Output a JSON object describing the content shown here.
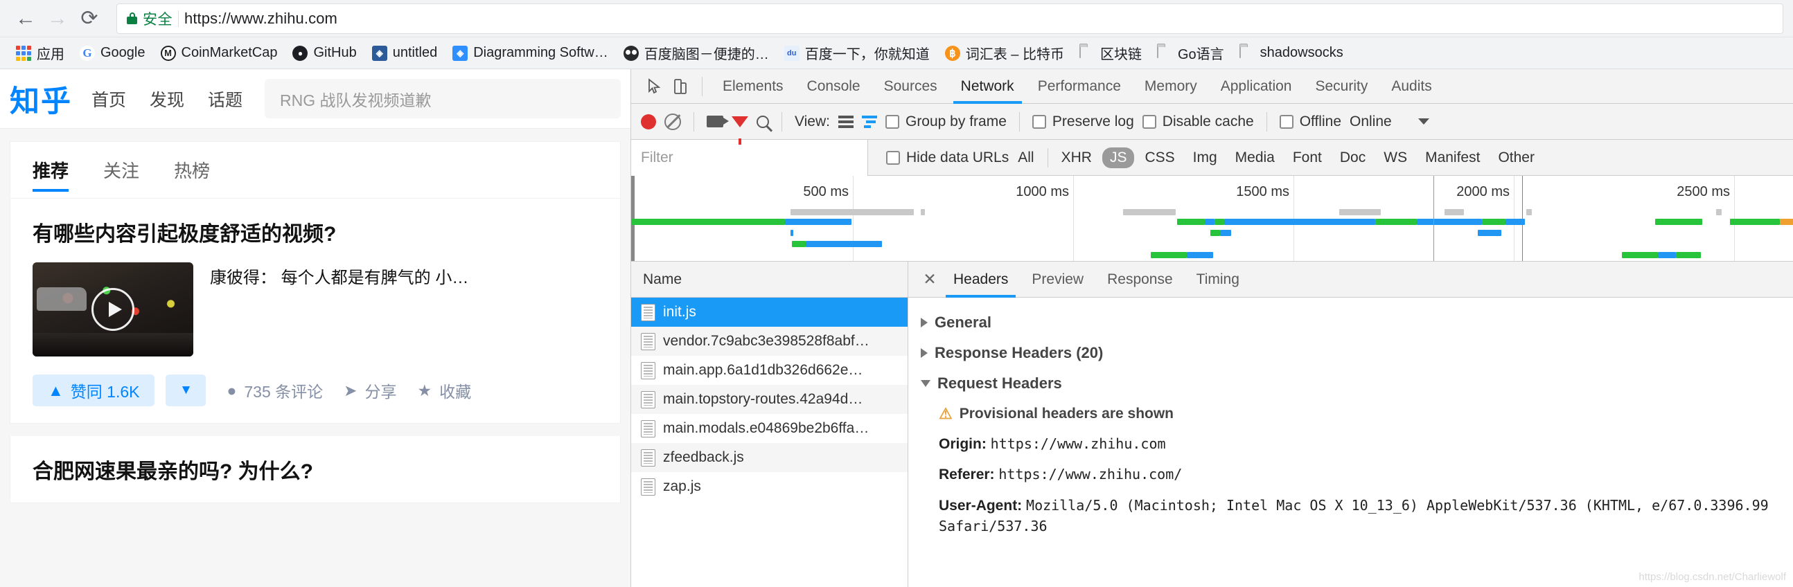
{
  "browser": {
    "back_icon": "←",
    "forward_icon": "→",
    "reload_icon": "⟳",
    "secure_label": "安全",
    "url": "https://www.zhihu.com",
    "url_scheme": "https",
    "url_sep": "://",
    "url_host": "www.zhihu.com"
  },
  "bookmarks": [
    {
      "label": "应用",
      "icon": "apps-grid-icon",
      "kind": "apps"
    },
    {
      "label": "Google",
      "icon": "google-icon",
      "kind": "google"
    },
    {
      "label": "CoinMarketCap",
      "icon": "coinmarketcap-icon",
      "kind": "cmc"
    },
    {
      "label": "GitHub",
      "icon": "github-icon",
      "kind": "github"
    },
    {
      "label": "untitled",
      "icon": "diagram-app-icon",
      "kind": "draw-dark"
    },
    {
      "label": "Diagramming Softw…",
      "icon": "diagram-app-icon",
      "kind": "draw-blue"
    },
    {
      "label": "百度脑图－便捷的…",
      "icon": "baidu-naotu-icon",
      "kind": "panda"
    },
    {
      "label": "百度一下，你就知道",
      "icon": "baidu-icon",
      "kind": "baidu"
    },
    {
      "label": "词汇表 – 比特币",
      "icon": "bitcoin-icon",
      "kind": "btc"
    },
    {
      "label": "区块链",
      "icon": "folder-icon",
      "kind": "folder"
    },
    {
      "label": "Go语言",
      "icon": "folder-icon",
      "kind": "folder"
    },
    {
      "label": "shadowsocks",
      "icon": "folder-icon",
      "kind": "folder"
    }
  ],
  "zhihu": {
    "logo": "知乎",
    "nav": [
      "首页",
      "发现",
      "话题"
    ],
    "search_placeholder": "RNG 战队发视频道歉",
    "feed_tabs": [
      {
        "label": "推荐",
        "active": true
      },
      {
        "label": "关注",
        "active": false
      },
      {
        "label": "热榜",
        "active": false
      }
    ],
    "question_title": "有哪些内容引起极度舒适的视频?",
    "answer_author": "康彼得：",
    "answer_excerpt": "每个人都是有脾气的 小…",
    "vote_label": "赞同 1.6K",
    "vote_up_icon": "▲",
    "vote_down_icon": "▼",
    "comment_label": "735 条评论",
    "comment_icon": "●",
    "share_label": "分享",
    "share_icon": "➤",
    "favorite_label": "收藏",
    "favorite_icon": "★",
    "next_question_title": "合肥网速果最亲的吗? 为什么?",
    "accent": "#0084ff"
  },
  "devtools": {
    "inspect_icon": "inspect-cursor-icon",
    "device_icon": "device-toolbar-icon",
    "tabs": [
      {
        "label": "Elements",
        "active": false
      },
      {
        "label": "Console",
        "active": false
      },
      {
        "label": "Sources",
        "active": false
      },
      {
        "label": "Network",
        "active": true
      },
      {
        "label": "Performance",
        "active": false
      },
      {
        "label": "Memory",
        "active": false
      },
      {
        "label": "Application",
        "active": false
      },
      {
        "label": "Security",
        "active": false
      },
      {
        "label": "Audits",
        "active": false
      }
    ],
    "toolbar": {
      "record_icon": "record-button",
      "clear_icon": "clear-icon",
      "capture_screenshots_icon": "camera-icon",
      "filter_icon": "filter-icon",
      "search_icon": "search-icon",
      "view_label": "View:",
      "view_list_icon": "list-view-icon",
      "view_waterfall_icon": "waterfall-view-icon",
      "group_by_frame": "Group by frame",
      "preserve_log": "Preserve log",
      "disable_cache": "Disable cache",
      "offline": "Offline",
      "throttling": "Online",
      "more_icon": "chevron-down-icon"
    },
    "filterbar": {
      "filter_placeholder": "Filter",
      "hide_data_urls": "Hide data URLs",
      "types": [
        {
          "label": "All",
          "active": false
        },
        {
          "label": "XHR",
          "active": false
        },
        {
          "label": "JS",
          "active": true
        },
        {
          "label": "CSS",
          "active": false
        },
        {
          "label": "Img",
          "active": false
        },
        {
          "label": "Media",
          "active": false
        },
        {
          "label": "Font",
          "active": false
        },
        {
          "label": "Doc",
          "active": false
        },
        {
          "label": "WS",
          "active": false
        },
        {
          "label": "Manifest",
          "active": false
        },
        {
          "label": "Other",
          "active": false
        }
      ]
    },
    "overview": {
      "ticks": [
        "500 ms",
        "1000 ms",
        "1500 ms",
        "2000 ms",
        "2500 ms"
      ],
      "tick_x": [
        210,
        400,
        590,
        780,
        970
      ]
    },
    "requests": {
      "column_header": "Name",
      "rows": [
        {
          "name": "init.js",
          "selected": true
        },
        {
          "name": "vendor.7c9abc3e398528f8abf…",
          "selected": false
        },
        {
          "name": "main.app.6a1d1db326d662e…",
          "selected": false
        },
        {
          "name": "main.topstory-routes.42a94d…",
          "selected": false
        },
        {
          "name": "main.modals.e04869be2b6ffa…",
          "selected": false
        },
        {
          "name": "zfeedback.js",
          "selected": false
        },
        {
          "name": "zap.js",
          "selected": false
        }
      ]
    },
    "detail": {
      "close_icon": "close-icon",
      "tabs": [
        {
          "label": "Headers",
          "active": true
        },
        {
          "label": "Preview",
          "active": false
        },
        {
          "label": "Response",
          "active": false
        },
        {
          "label": "Timing",
          "active": false
        }
      ],
      "sections": [
        {
          "label": "General",
          "open": false
        },
        {
          "label": "Response Headers (20)",
          "open": false
        },
        {
          "label": "Request Headers",
          "open": true
        }
      ],
      "warning_icon": "warning-triangle-icon",
      "warning_text": "Provisional headers are shown",
      "headers": [
        {
          "key": "Origin:",
          "value": "https://www.zhihu.com"
        },
        {
          "key": "Referer:",
          "value": "https://www.zhihu.com/"
        },
        {
          "key": "User-Agent:",
          "value": "Mozilla/5.0 (Macintosh; Intel Mac OS X 10_13_6) AppleWebKit/537.36 (KHTML, e/67.0.3396.99 Safari/537.36"
        }
      ]
    },
    "watermark": "https://blog.csdn.net/Charliewolf"
  }
}
